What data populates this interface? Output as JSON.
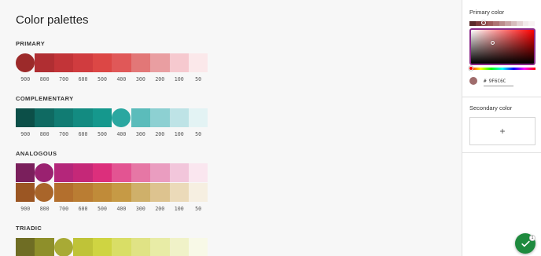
{
  "page_title": "Color palettes",
  "shade_labels": [
    "900",
    "800",
    "700",
    "600",
    "500",
    "400",
    "300",
    "200",
    "100",
    "50"
  ],
  "sections": {
    "primary": {
      "label": "PRIMARY",
      "rows": [
        {
          "selected_index": 0,
          "colors": [
            "#9c2a2a",
            "#b02e32",
            "#c23438",
            "#d03c3f",
            "#dc4745",
            "#e05858",
            "#e27777",
            "#e99ea1",
            "#f6c9cf",
            "#fbe8ea"
          ]
        }
      ]
    },
    "complementary": {
      "label": "COMPLEMENTARY",
      "rows": [
        {
          "selected_index": 5,
          "colors": [
            "#0c4f48",
            "#0f6a62",
            "#117c73",
            "#138b81",
            "#15988d",
            "#2aa7a0",
            "#5bbcbb",
            "#8dd0d2",
            "#bee3e6",
            "#e3f3f4"
          ]
        }
      ]
    },
    "analogous": {
      "label": "ANALOGOUS",
      "rows": [
        {
          "selected_index": 1,
          "colors": [
            "#7a1f5c",
            "#9a2170",
            "#b4267a",
            "#c52878",
            "#dc2f7c",
            "#e35492",
            "#e677a5",
            "#ea9dc0",
            "#f2c6db",
            "#fae6ef"
          ]
        },
        {
          "selected_index": 1,
          "colors": [
            "#9b5623",
            "#a9652a",
            "#b36f2d",
            "#ba7d33",
            "#c08b39",
            "#c69a45",
            "#cfb06a",
            "#ddc38f",
            "#ebdab9",
            "#f6efe1"
          ]
        }
      ]
    },
    "triadic": {
      "label": "TRIADIC",
      "rows": [
        {
          "selected_index": 2,
          "colors": [
            "#6f6d24",
            "#8e8f2a",
            "#a8aa35",
            "#bfc338",
            "#cfd442",
            "#d9de66",
            "#e0e385",
            "#e8eca6",
            "#f0f2c8",
            "#f8f9e7"
          ]
        }
      ]
    }
  },
  "side_panel": {
    "primary_title": "Primary color",
    "primary_hex": "9F6C6C",
    "hex_prefix": "#",
    "primary_color": "#9f6c6c",
    "thumb_strip": [
      "#5a2a2a",
      "#7a3a3a",
      "#8f4b4b",
      "#9f5c5c",
      "#ad7373",
      "#bb8c8c",
      "#c9a4a4",
      "#d6bcbc",
      "#e4d4d4",
      "#f1eaea",
      "#f8f3f3"
    ],
    "secondary_title": "Secondary color",
    "add_label": "+"
  },
  "fab": {
    "icon": "check-icon",
    "badge": "1",
    "color": "#1e8a3e"
  }
}
